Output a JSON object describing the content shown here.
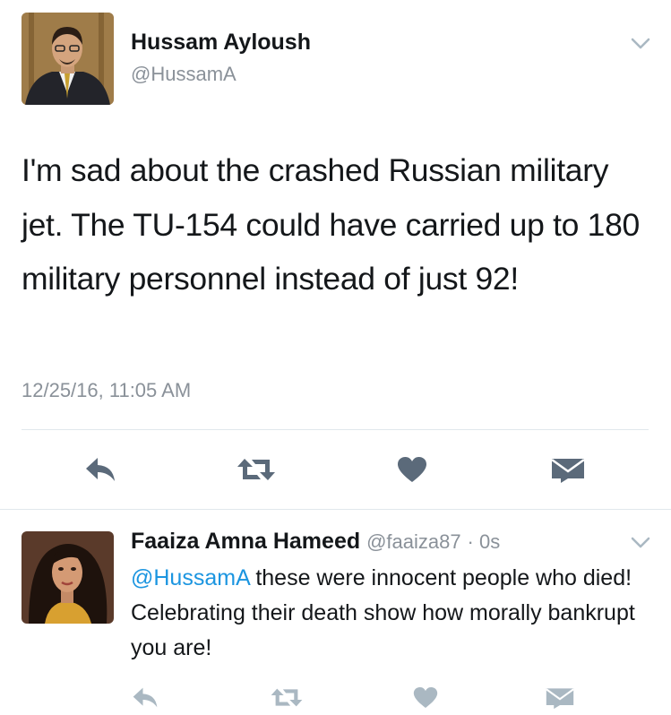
{
  "main_tweet": {
    "author_name": "Hussam Ayloush",
    "author_handle": "@HussamA",
    "text": "I'm sad about the crashed Russian military jet. The TU-154 could have carried up to 180 military personnel instead of just 92!",
    "timestamp": "12/25/16, 11:05 AM",
    "icons": {
      "menu": "chevron-down-icon",
      "reply": "reply-icon",
      "retweet": "retweet-icon",
      "like": "heart-icon",
      "dm": "envelope-icon"
    }
  },
  "reply_tweet": {
    "author_name": "Faaiza Amna Hameed",
    "author_handle": "@faaiza87",
    "time_ago": "· 0s",
    "mention": "@HussamA",
    "text": " these were innocent people who died! Celebrating their death show how morally bankrupt you are!"
  },
  "colors": {
    "text": "#14171a",
    "muted": "#8a9199",
    "icon": "#5b6a7a",
    "mention": "#1b95e0",
    "divider": "#e1e8ed"
  }
}
